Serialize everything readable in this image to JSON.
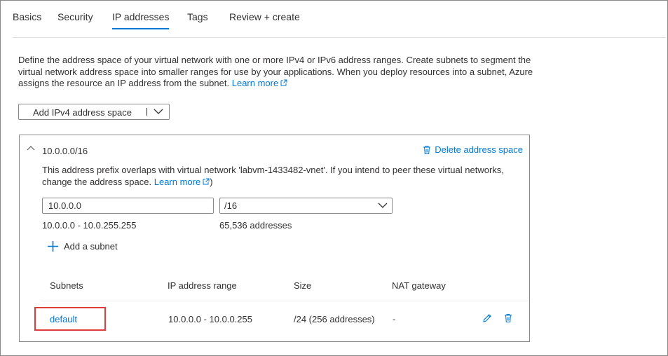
{
  "tabs": [
    {
      "label": "Basics",
      "active": false
    },
    {
      "label": "Security",
      "active": false
    },
    {
      "label": "IP addresses",
      "active": true
    },
    {
      "label": "Tags",
      "active": false
    },
    {
      "label": "Review + create",
      "active": false
    }
  ],
  "description": {
    "text": "Define the address space of your virtual network with one or more IPv4 or IPv6 address ranges. Create subnets to segment the virtual network address space into smaller ranges for use by your applications. When you deploy resources into a subnet, Azure assigns the resource an IP address from the subnet.",
    "link_label": "Learn more"
  },
  "add_address_button": {
    "label": "Add IPv4 address space"
  },
  "address_space": {
    "prefix": "10.0.0.0/16",
    "delete_label": "Delete address space",
    "warning_text": "This address prefix overlaps with virtual network 'labvm-1433482-vnet'. If you intend to peer these virtual networks, change the address space.",
    "warning_link_label": "Learn more",
    "ip_value": "10.0.0.0",
    "cidr_value": "/16",
    "range": "10.0.0.0 - 10.0.255.255",
    "address_count": "65,536 addresses",
    "add_subnet_label": "Add a subnet"
  },
  "subnet_table": {
    "columns": [
      "Subnets",
      "IP address range",
      "Size",
      "NAT gateway"
    ],
    "rows": [
      {
        "name": "default",
        "ip_range": "10.0.0.0 - 10.0.0.255",
        "size": "/24 (256 addresses)",
        "nat_gateway": "-"
      }
    ]
  },
  "colors": {
    "accent": "#0078d4",
    "highlight": "#e03c3c",
    "border": "#8a8886"
  }
}
